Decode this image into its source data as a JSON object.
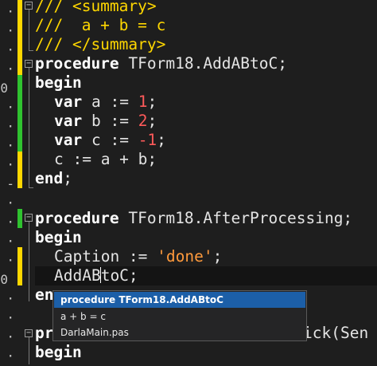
{
  "gutter": {
    "line_number_1": "0",
    "line_number_2": "0",
    "dot": "·",
    "dash": "-"
  },
  "icons": {
    "fold_collapse": "−"
  },
  "code": {
    "line1_comment": "/// <summary>",
    "line2_comment": "///  a + b = c",
    "line3_comment": "/// </summary>",
    "line4_kw": "procedure",
    "line4_rest": " TForm18.AddABtoC;",
    "line5_kw": "begin",
    "line6_kw": "var",
    "line6_mid": " a := ",
    "line6_num": "1",
    "line6_end": ";",
    "line7_kw": "var",
    "line7_mid": " b := ",
    "line7_num": "2",
    "line7_end": ";",
    "line8_kw": "var",
    "line8_mid": " c := ",
    "line8_num": "-1",
    "line8_end": ";",
    "line9_text": "c := a + b;",
    "line10_kw": "end",
    "line10_end": ";",
    "line12_kw": "procedure",
    "line12_rest": " TForm18.AfterProcessing;",
    "line13_kw": "begin",
    "line14_pre": "Caption := ",
    "line14_str": "'done'",
    "line14_end": ";",
    "line15_before_caret": "AddAB",
    "line15_after_caret": "toC;",
    "line16_kw": "en",
    "line17_kw": "pr",
    "line17_tail": "ick(Sen",
    "line18_kw": "begin"
  },
  "popup": {
    "items": [
      "procedure TForm18.AddABtoC",
      "a + b = c",
      "DarlaMain.pas"
    ],
    "selected_index": 0
  },
  "colors": {
    "background": "#1e1e1e",
    "modified_unsaved": "#ffd700",
    "modified_saved": "#2fc22f",
    "comment": "#ffd700",
    "number": "#ff5a5a",
    "string": "#ff9a3c",
    "popup_selection": "#1c5fa8"
  }
}
